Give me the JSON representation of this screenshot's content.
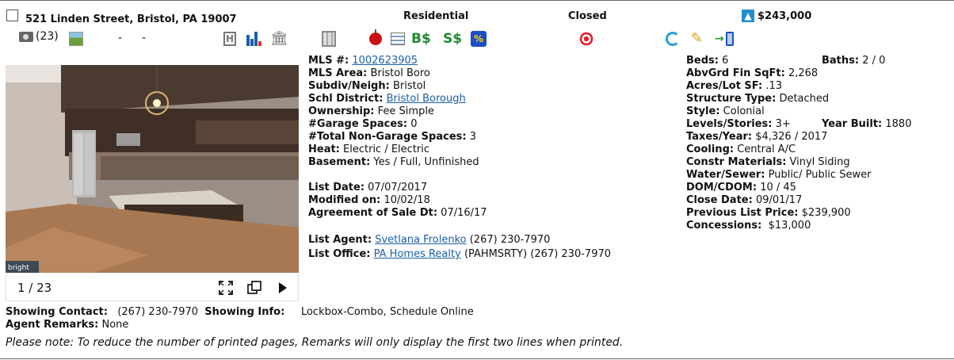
{
  "header": {
    "address": "521 Linden Street, Bristol, PA 19007",
    "property_type": "Residential",
    "status": "Closed",
    "price": "$243,000"
  },
  "icon_row": {
    "photo_count": "(23)",
    "dash1": "-",
    "dash2": "-"
  },
  "photo": {
    "counter": "1 / 23",
    "watermark": "bright"
  },
  "details_left": {
    "mls_label": "MLS #:",
    "mls_value": "1002623905",
    "area_label": "MLS Area:",
    "area_value": "Bristol Boro",
    "subdiv_label": "Subdiv/Neigh:",
    "subdiv_value": "Bristol",
    "school_label": "Schl District:",
    "school_value": "Bristol Borough",
    "ownership_label": "Ownership:",
    "ownership_value": "Fee Simple",
    "garage_label": "#Garage Spaces:",
    "garage_value": "0",
    "nongarage_label": "#Total Non-Garage Spaces:",
    "nongarage_value": "3",
    "heat_label": "Heat:",
    "heat_value": "Electric / Electric",
    "basement_label": "Basement:",
    "basement_value": "Yes / Full, Unfinished",
    "listdate_label": "List Date:",
    "listdate_value": "07/07/2017",
    "modified_label": "Modified on:",
    "modified_value": "10/02/18",
    "agreement_label": "Agreement of Sale Dt:",
    "agreement_value": "07/16/17",
    "agent_label": "List Agent:",
    "agent_name": "Svetlana Frolenko",
    "agent_phone": "(267) 230-7970",
    "office_label": "List Office:",
    "office_name": "PA Homes Realty",
    "office_rest": "(PAHMSRTY) (267) 230-7970"
  },
  "details_right": {
    "beds_label": "Beds:",
    "beds_value": "6",
    "sqft_label": "AbvGrd Fin SqFt:",
    "sqft_value": "2,268",
    "acres_label": "Acres/Lot SF:",
    "acres_value": ".13",
    "structure_label": "Structure Type:",
    "structure_value": "Detached",
    "style_label": "Style:",
    "style_value": "Colonial",
    "levels_label": "Levels/Stories:",
    "levels_value": "3+",
    "taxes_label": "Taxes/Year:",
    "taxes_value": "$4,326 / 2017",
    "cooling_label": "Cooling:",
    "cooling_value": "Central A/C",
    "constr_label": "Constr Materials:",
    "constr_value": "Vinyl Siding",
    "water_label": "Water/Sewer:",
    "water_value": "Public/ Public Sewer",
    "dom_label": "DOM/CDOM:",
    "dom_value": "10 / 45",
    "close_label": "Close Date:",
    "close_value": "09/01/17",
    "prev_label": "Previous List Price:",
    "prev_value": "$239,900",
    "conc_label": "Concessions:",
    "conc_value": "$13,000",
    "baths_label": "Baths:",
    "baths_value": "2 / 0",
    "year_label": "Year Built:",
    "year_value": "1880"
  },
  "bottom": {
    "showing_contact_label": "Showing Contact:",
    "showing_contact_value": "(267) 230-7970",
    "showing_info_label": "Showing Info:",
    "showing_info_value": "Lockbox-Combo, Schedule Online",
    "remarks_label": "Agent Remarks:",
    "remarks_value": "None",
    "note": "Please note: To reduce the number of printed pages, Remarks will only display the first two lines when printed."
  },
  "colors": {
    "link": "#1a5fa8",
    "price_arrow": "#1f8fd0",
    "dollar_green": "#1f8a2e"
  },
  "icons": [
    "camera-icon",
    "gallery-icon",
    "history-icon",
    "chart-icon",
    "bank-icon",
    "map-icon",
    "school-apple-icon",
    "document-icon",
    "buyer-dollar-icon",
    "seller-dollar-icon",
    "percent-icon",
    "target-icon",
    "refresh-icon",
    "edit-icon",
    "mobile-icon"
  ]
}
